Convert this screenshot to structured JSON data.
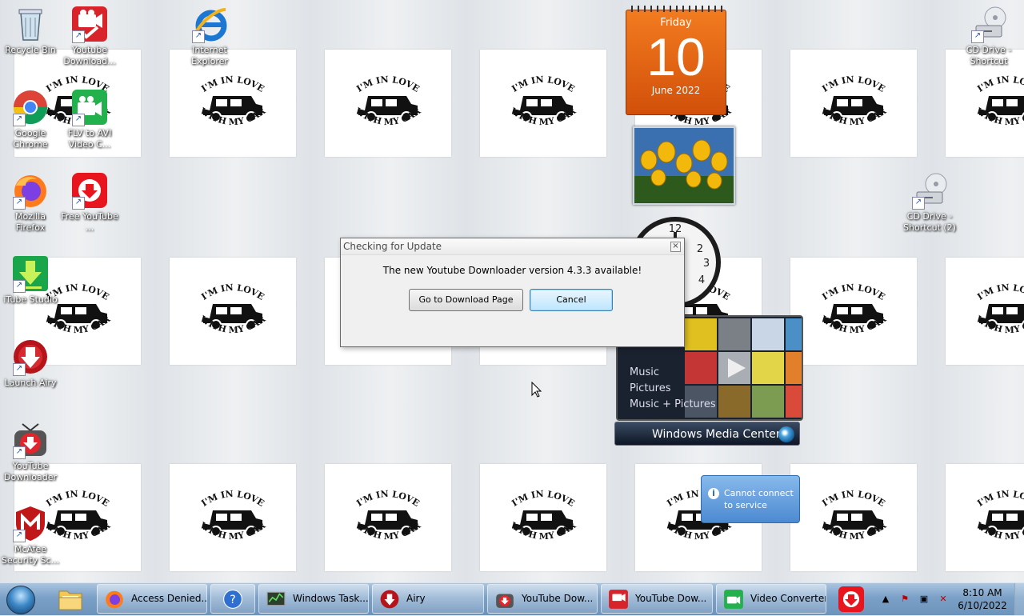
{
  "desktop_icons": [
    {
      "label": "Recycle Bin",
      "icon": "recycle-bin-icon"
    },
    {
      "label": "Youtube Download...",
      "icon": "youtube-downloader-red-icon"
    },
    {
      "label": "Internet Explorer",
      "icon": "internet-explorer-icon"
    },
    {
      "label": "CD Drive - Shortcut",
      "icon": "cd-drive-icon"
    },
    {
      "label": "Google Chrome",
      "icon": "chrome-icon"
    },
    {
      "label": "FLV to AVI Video C...",
      "icon": "video-converter-icon"
    },
    {
      "label": "Mozilla Firefox",
      "icon": "firefox-icon"
    },
    {
      "label": "Free YouTube ...",
      "icon": "free-youtube-icon"
    },
    {
      "label": "CD Drive - Shortcut (2)",
      "icon": "cd-drive-icon"
    },
    {
      "label": "iTube Studio",
      "icon": "itube-studio-icon"
    },
    {
      "label": "Launch Airy",
      "icon": "airy-icon"
    },
    {
      "label": "YouTube Downloader",
      "icon": "youtube-downloader-tv-icon"
    },
    {
      "label": "McAfee Security Sc...",
      "icon": "mcafee-icon"
    }
  ],
  "wallpaper_text": {
    "line1": "I'M IN LOVE",
    "line2": "WITH MY CAR"
  },
  "calendar": {
    "weekday": "Friday",
    "day": "10",
    "month_year": "June 2022"
  },
  "media_center": {
    "menu": [
      "Music",
      "Pictures",
      "Music + Pictures"
    ],
    "title_a": "Windows",
    "title_b": "Media Center"
  },
  "notification": {
    "text": "Cannot connect to service"
  },
  "dialog": {
    "title": "Checking for Update",
    "message": "The new Youtube Downloader version 4.3.3 available!",
    "download_label": "Go to Download Page",
    "cancel_label": "Cancel",
    "close_glyph": "×"
  },
  "taskbar": {
    "items": [
      {
        "label": "Access Denied...",
        "icon": "firefox-icon"
      },
      {
        "label": "",
        "icon": "help-icon"
      },
      {
        "label": "Windows Task...",
        "icon": "task-manager-icon"
      },
      {
        "label": "Airy",
        "icon": "airy-icon"
      },
      {
        "label": "YouTube Dow...",
        "icon": "youtube-downloader-tv-icon"
      },
      {
        "label": "YouTube Dow...",
        "icon": "youtube-downloader-red-icon"
      },
      {
        "label": "Video Converter",
        "icon": "video-converter-icon"
      }
    ],
    "time": "8:10 AM",
    "date": "6/10/2022"
  },
  "colors": {
    "calendar": "#e5651a",
    "taskbar": "#7aa0c7",
    "notification": "#4c8ad1"
  }
}
